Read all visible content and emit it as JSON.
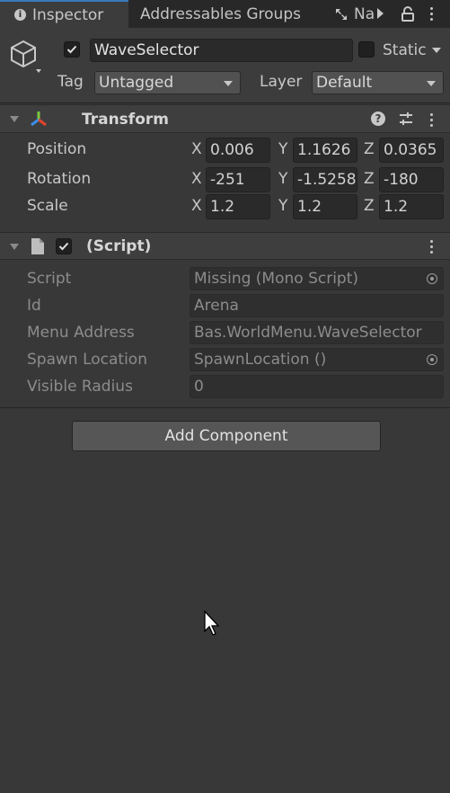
{
  "tabs": [
    {
      "label": "Inspector",
      "active": true
    },
    {
      "label": "Addressables Groups",
      "active": false
    },
    {
      "label": "Na",
      "active": false
    }
  ],
  "object": {
    "name": "WaveSelector",
    "active": true,
    "static_label": "Static",
    "tag_label": "Tag",
    "tag_value": "Untagged",
    "layer_label": "Layer",
    "layer_value": "Default"
  },
  "transform": {
    "title": "Transform",
    "rows": [
      {
        "label": "Position",
        "x": "0.006",
        "y": "1.1626",
        "z": "0.0365"
      },
      {
        "label": "Rotation",
        "x": "-251",
        "y": "-1.5258",
        "z": "-180"
      },
      {
        "label": "Scale",
        "x": "1.2",
        "y": "1.2",
        "z": "1.2"
      }
    ],
    "axis": {
      "x": "X",
      "y": "Y",
      "z": "Z"
    }
  },
  "script_component": {
    "title": "(Script)",
    "enabled": true,
    "fields": [
      {
        "label": "Script",
        "value": "Missing (Mono Script)"
      },
      {
        "label": "Id",
        "value": "Arena"
      },
      {
        "label": "Menu Address",
        "value": "Bas.WorldMenu.WaveSelector"
      },
      {
        "label": "Spawn Location",
        "value": "SpawnLocation ()"
      },
      {
        "label": "Visible Radius",
        "value": "0"
      }
    ]
  },
  "add_component_label": "Add Component",
  "colors": {
    "accent": "#3a79bb",
    "background": "#383838"
  }
}
